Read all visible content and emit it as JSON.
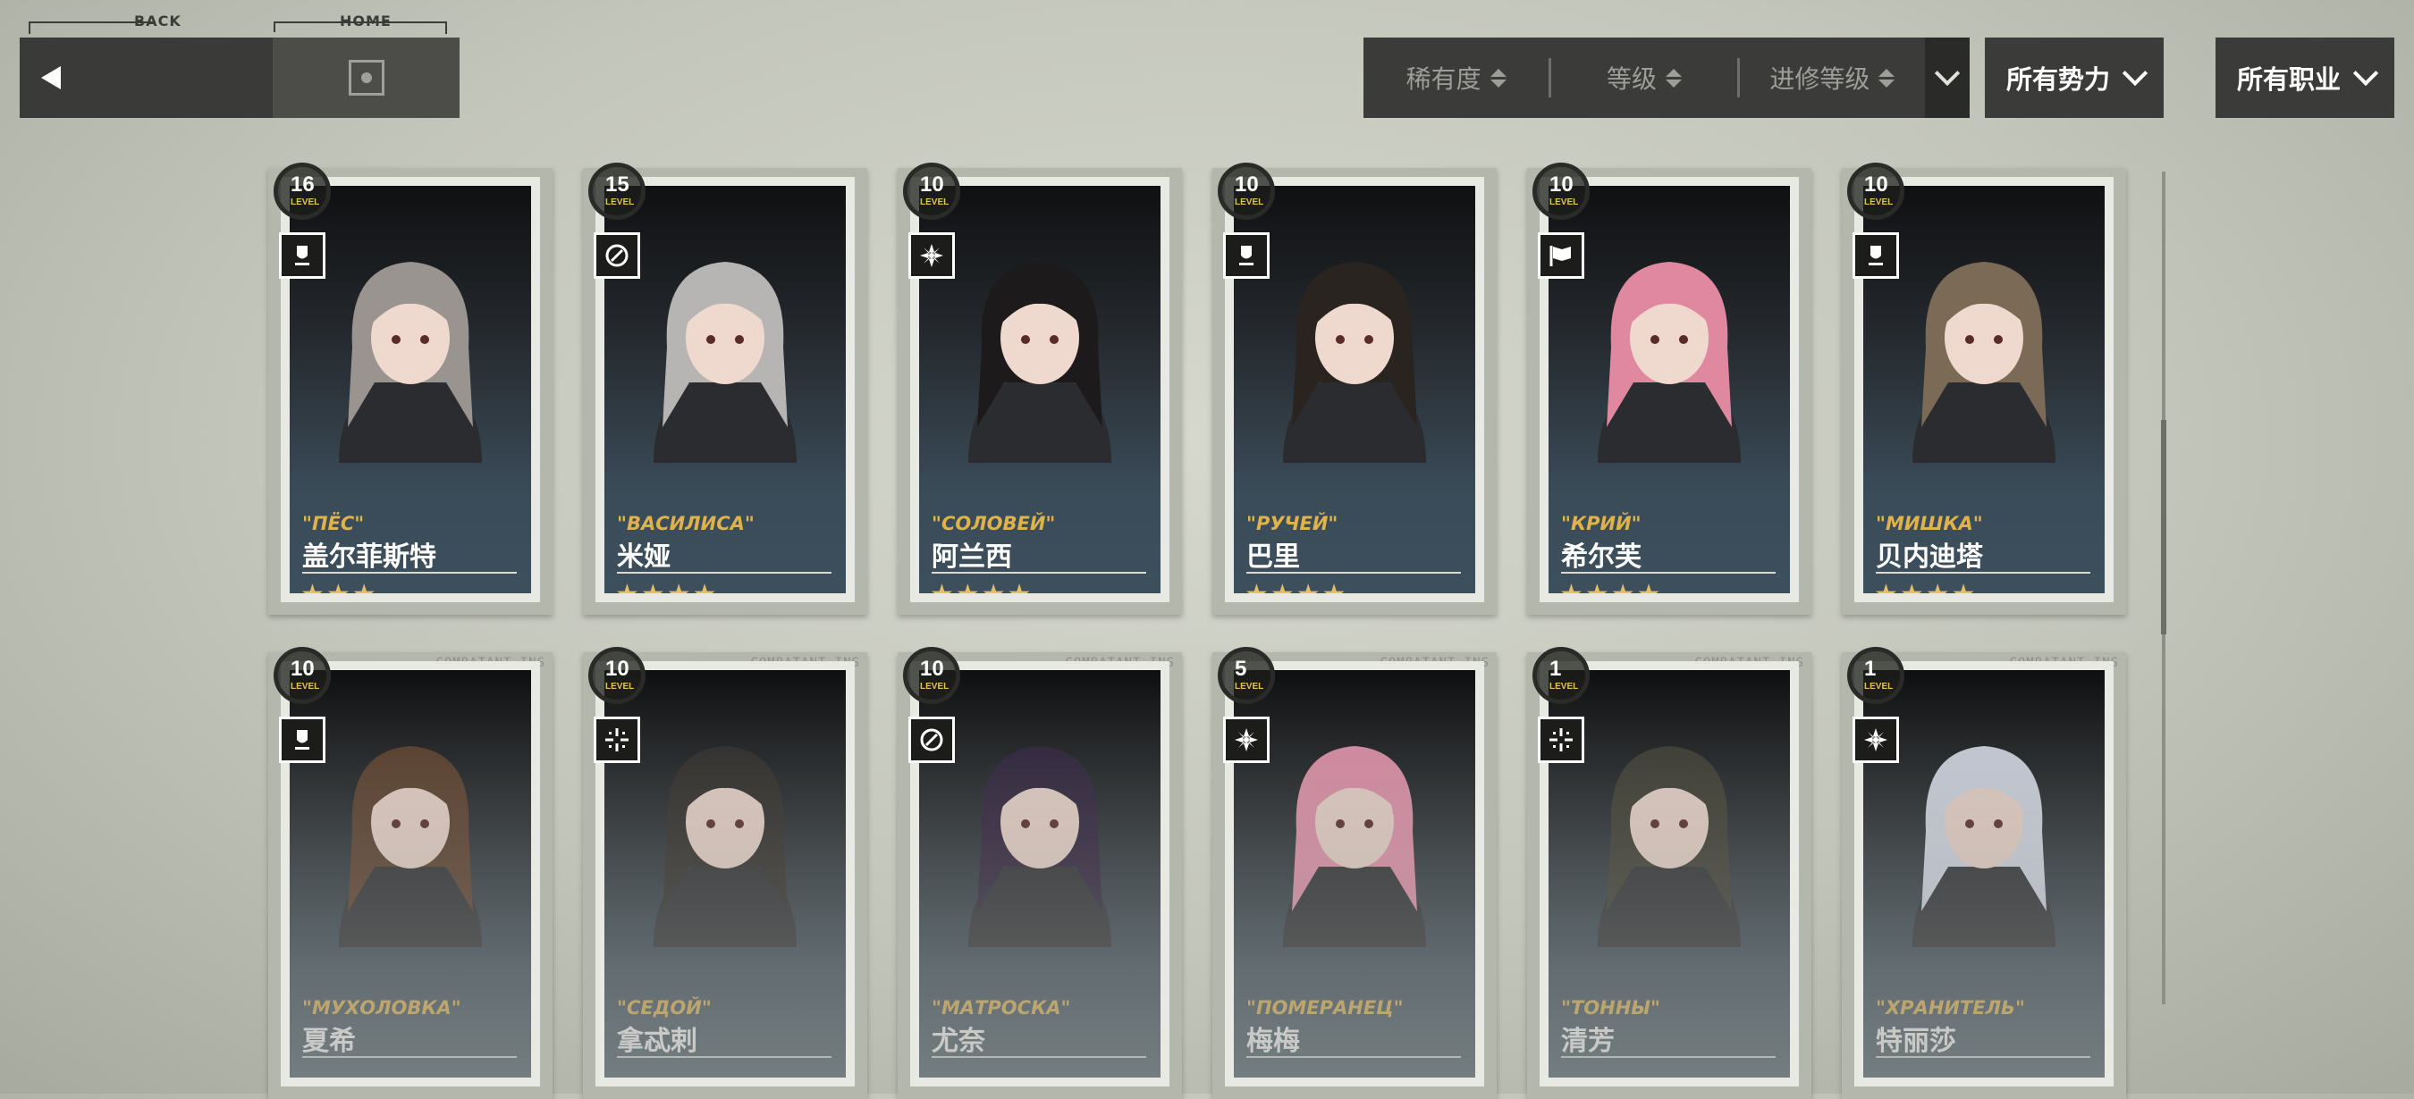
{
  "nav": {
    "back_caption": "BACK",
    "home_caption": "HOME"
  },
  "filters": {
    "sort": [
      "稀有度",
      "等级",
      "进修等级"
    ],
    "faction": "所有势力",
    "profession": "所有职业"
  },
  "cards": [
    {
      "level": "16",
      "level_label": "LEVEL",
      "codename": "\"ПЁС\"",
      "name": "盖尔菲斯特",
      "stars": "★★★",
      "class_icon": "defender-icon",
      "tag": ""
    },
    {
      "level": "15",
      "level_label": "LEVEL",
      "codename": "\"ВАСИЛИСА\"",
      "name": "米娅",
      "stars": "★★★★",
      "class_icon": "caster-icon",
      "tag": ""
    },
    {
      "level": "10",
      "level_label": "LEVEL",
      "codename": "\"СОЛОВЕЙ\"",
      "name": "阿兰西",
      "stars": "★★★★",
      "class_icon": "support-icon",
      "tag": ""
    },
    {
      "level": "10",
      "level_label": "LEVEL",
      "codename": "\"РУЧЕЙ\"",
      "name": "巴里",
      "stars": "★★★★",
      "class_icon": "defender-icon",
      "tag": ""
    },
    {
      "level": "10",
      "level_label": "LEVEL",
      "codename": "\"КРИЙ\"",
      "name": "希尔芙",
      "stars": "★★★★",
      "class_icon": "vanguard-flag-icon",
      "tag": ""
    },
    {
      "level": "10",
      "level_label": "LEVEL",
      "codename": "\"МИШКА\"",
      "name": "贝内迪塔",
      "stars": "★★★★",
      "class_icon": "defender-icon",
      "tag": ""
    },
    {
      "level": "10",
      "level_label": "LEVEL",
      "codename": "\"МУХОЛОВКА\"",
      "name": "夏希",
      "stars": "",
      "class_icon": "defender-icon",
      "tag": "COMBATANT_INS"
    },
    {
      "level": "10",
      "level_label": "LEVEL",
      "codename": "\"СЕДОЙ\"",
      "name": "拿忒剌",
      "stars": "",
      "class_icon": "sniper-icon",
      "tag": "COMBATANT_INS"
    },
    {
      "level": "10",
      "level_label": "LEVEL",
      "codename": "\"МАТРОСКА\"",
      "name": "尤奈",
      "stars": "",
      "class_icon": "caster-icon",
      "tag": "COMBATANT_INS"
    },
    {
      "level": "5",
      "level_label": "LEVEL",
      "codename": "\"ПОМЕРАНЕЦ\"",
      "name": "梅梅",
      "stars": "",
      "class_icon": "support-icon",
      "tag": "COMBATANT_INS"
    },
    {
      "level": "1",
      "level_label": "LEVEL",
      "codename": "\"ТОННЫ\"",
      "name": "清芳",
      "stars": "",
      "class_icon": "sniper-icon",
      "tag": "COMBATANT_INS"
    },
    {
      "level": "1",
      "level_label": "LEVEL",
      "codename": "\"ХРАНИТЕЛЬ\"",
      "name": "特丽莎",
      "stars": "",
      "class_icon": "support-icon",
      "tag": "COMBATANT_INS"
    }
  ]
}
